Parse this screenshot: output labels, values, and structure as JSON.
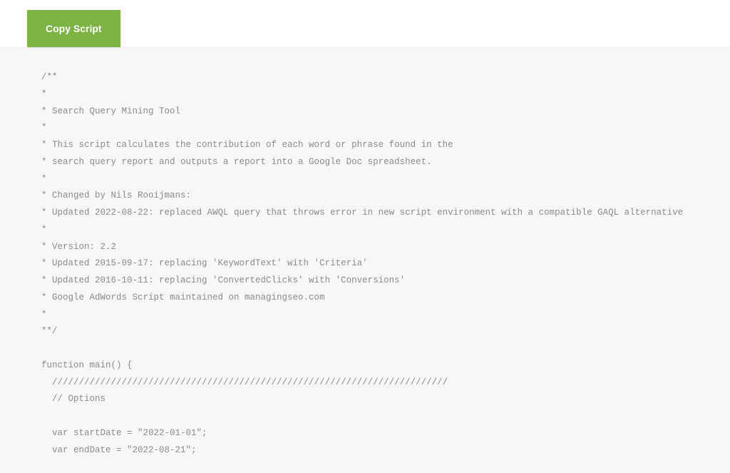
{
  "toolbar": {
    "copy_label": "Copy Script"
  },
  "code": {
    "l1": "/**",
    "l2": "*",
    "l3": "* Search Query Mining Tool",
    "l4": "*",
    "l5": "* This script calculates the contribution of each word or phrase found in the",
    "l6": "* search query report and outputs a report into a Google Doc spreadsheet.",
    "l7": "*",
    "l8": "* Changed by Nils Rooijmans:",
    "l9": "* Updated 2022-08-22: replaced AWQL query that throws error in new script environment with a compatible GAQL alternative",
    "l10": "*",
    "l11": "* Version: 2.2",
    "l12": "* Updated 2015-09-17: replacing 'KeywordText' with 'Criteria'",
    "l13": "* Updated 2016-10-11: replacing 'ConvertedClicks' with 'Conversions'",
    "l14": "* Google AdWords Script maintained on managingseo.com",
    "l15": "*",
    "l16": "**/",
    "l17": "",
    "l18": "function main() {",
    "l19": "  //////////////////////////////////////////////////////////////////////////",
    "l20": "  // Options",
    "l21": "",
    "l22": "  var startDate = \"2022-01-01\";",
    "l23": "  var endDate = \"2022-08-21\";"
  }
}
